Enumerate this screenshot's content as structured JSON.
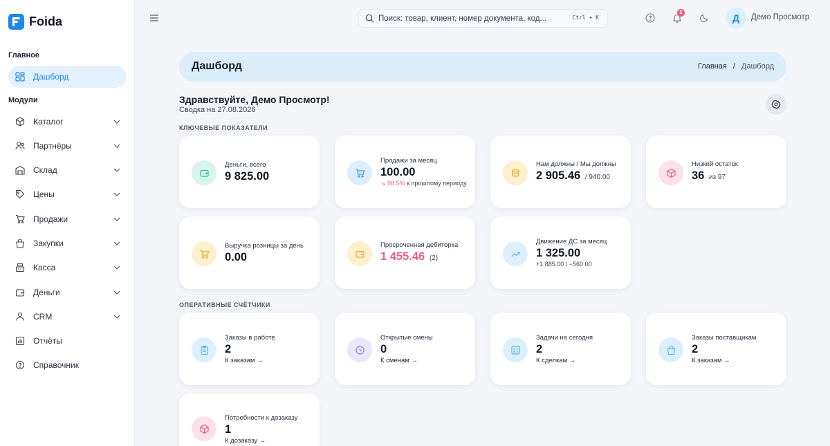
{
  "app": {
    "name": "Foida",
    "colors": {
      "accent": "#1e88e5",
      "negative": "#e8608a"
    }
  },
  "sidebar": {
    "main_label": "Главное",
    "modules_label": "Модули",
    "dashboard": {
      "label": "Дашборд",
      "icon": "dashboard-icon"
    },
    "items": [
      {
        "label": "Каталог",
        "icon": "box-icon",
        "expandable": true
      },
      {
        "label": "Партнёры",
        "icon": "users-icon",
        "expandable": true
      },
      {
        "label": "Склад",
        "icon": "warehouse-icon",
        "expandable": true
      },
      {
        "label": "Цены",
        "icon": "tag-icon",
        "expandable": true
      },
      {
        "label": "Продажи",
        "icon": "cart-icon",
        "expandable": true
      },
      {
        "label": "Закупки",
        "icon": "bag-icon",
        "expandable": true
      },
      {
        "label": "Касса",
        "icon": "cash-register-icon",
        "expandable": true
      },
      {
        "label": "Деньги",
        "icon": "wallet-icon",
        "expandable": true
      },
      {
        "label": "CRM",
        "icon": "crm-icon",
        "expandable": true
      },
      {
        "label": "Отчёты",
        "icon": "chart-icon",
        "expandable": false
      },
      {
        "label": "Справочник",
        "icon": "help-icon",
        "expandable": false
      }
    ]
  },
  "topbar": {
    "search_placeholder": "Поиск: товар, клиент, номер документа, код...",
    "search_shortcut": "Ctrl + K",
    "notifications_count": "2",
    "avatar_letter": "Д",
    "user_name": "Демо Просмотр"
  },
  "page": {
    "title": "Дашборд",
    "breadcrumb": {
      "home": "Главная",
      "separator": "/",
      "current": "Дашборд"
    },
    "greeting": "Здравствуйте, Демо Просмотр!",
    "summary": "Сводка на 27.08.2026"
  },
  "kpi": {
    "label": "КЛЮЧЕВЫЕ ПОКАЗАТЕЛИ",
    "money": {
      "label": "Деньги, всего",
      "value": "9 825.00"
    },
    "sales": {
      "label": "Продажи за месяц",
      "value": "100.00",
      "delta": "↘ 98.5%",
      "delta_text": " к прошлому периоду"
    },
    "debts": {
      "label": "Нам должны / Мы должны",
      "value": "2 905.46",
      "sub": "/ 940.00"
    },
    "low_stock": {
      "label": "Низкий остаток",
      "value": "36",
      "sub": "из 97"
    },
    "retail": {
      "label": "Выручка розницы за день",
      "value": "0.00"
    },
    "overdue": {
      "label": "Просроченная дебиторка",
      "value": "1 455.46",
      "sub": "(2)"
    },
    "cashflow": {
      "label": "Движение ДС за месяц",
      "value": "1 325.00",
      "note": "+1 885.00 / −560.00"
    }
  },
  "counters": {
    "label": "ОПЕРАТИВНЫЕ СЧЁТЧИКИ",
    "orders": {
      "label": "Заказы в работе",
      "value": "2",
      "link": "К заказам →"
    },
    "shifts": {
      "label": "Открытые смены",
      "value": "0",
      "link": "К сменам →"
    },
    "tasks": {
      "label": "Задачи на сегодня",
      "value": "2",
      "link": "К сделкам →"
    },
    "supplier_orders": {
      "label": "Заказы поставщикам",
      "value": "2",
      "link": "К заказам →"
    },
    "reorder": {
      "label": "Потребности к дозаказу",
      "value": "1",
      "link": "К дозаказу →"
    }
  }
}
